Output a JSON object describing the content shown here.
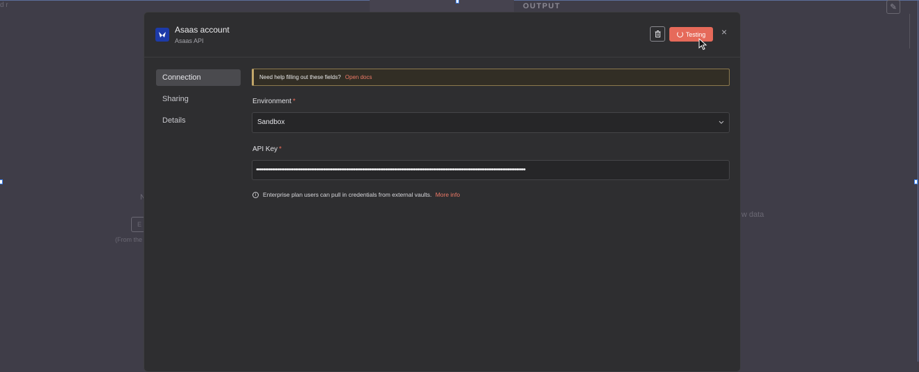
{
  "background": {
    "output_label": "OUTPUT",
    "edit_icon": "pencil-icon",
    "corner_text": "d r",
    "left_text": "N",
    "left_button_text": "E",
    "left_small_text": "(From the",
    "right_text": "w data"
  },
  "modal": {
    "title": "Asaas account",
    "subtitle": "Asaas API",
    "app_icon": "asaas-logo-icon",
    "delete_icon": "trash-icon",
    "testing_label": "Testing",
    "close_glyph": "×",
    "colors": {
      "accent": "#e66a5a",
      "link": "#ef7a67",
      "banner_border": "#c3a769"
    }
  },
  "sidebar": {
    "items": [
      {
        "label": "Connection",
        "active": true
      },
      {
        "label": "Sharing",
        "active": false
      },
      {
        "label": "Details",
        "active": false
      }
    ]
  },
  "content": {
    "help_text": "Need help filling out these fields?",
    "help_link": "Open docs",
    "environment_label": "Environment",
    "required_mark": "*",
    "environment_value": "Sandbox",
    "api_key_label": "API Key",
    "api_key_value": "••••••••••••••••••••••••••••••••••••••••••••••••••••••••••••••••••••••••••••••••••••••••••••••••••••••••••••••••••••••••••••••••••••••••••••••••••••••••",
    "info_text": "Enterprise plan users can pull in credentials from external vaults.",
    "info_link": "More info"
  }
}
